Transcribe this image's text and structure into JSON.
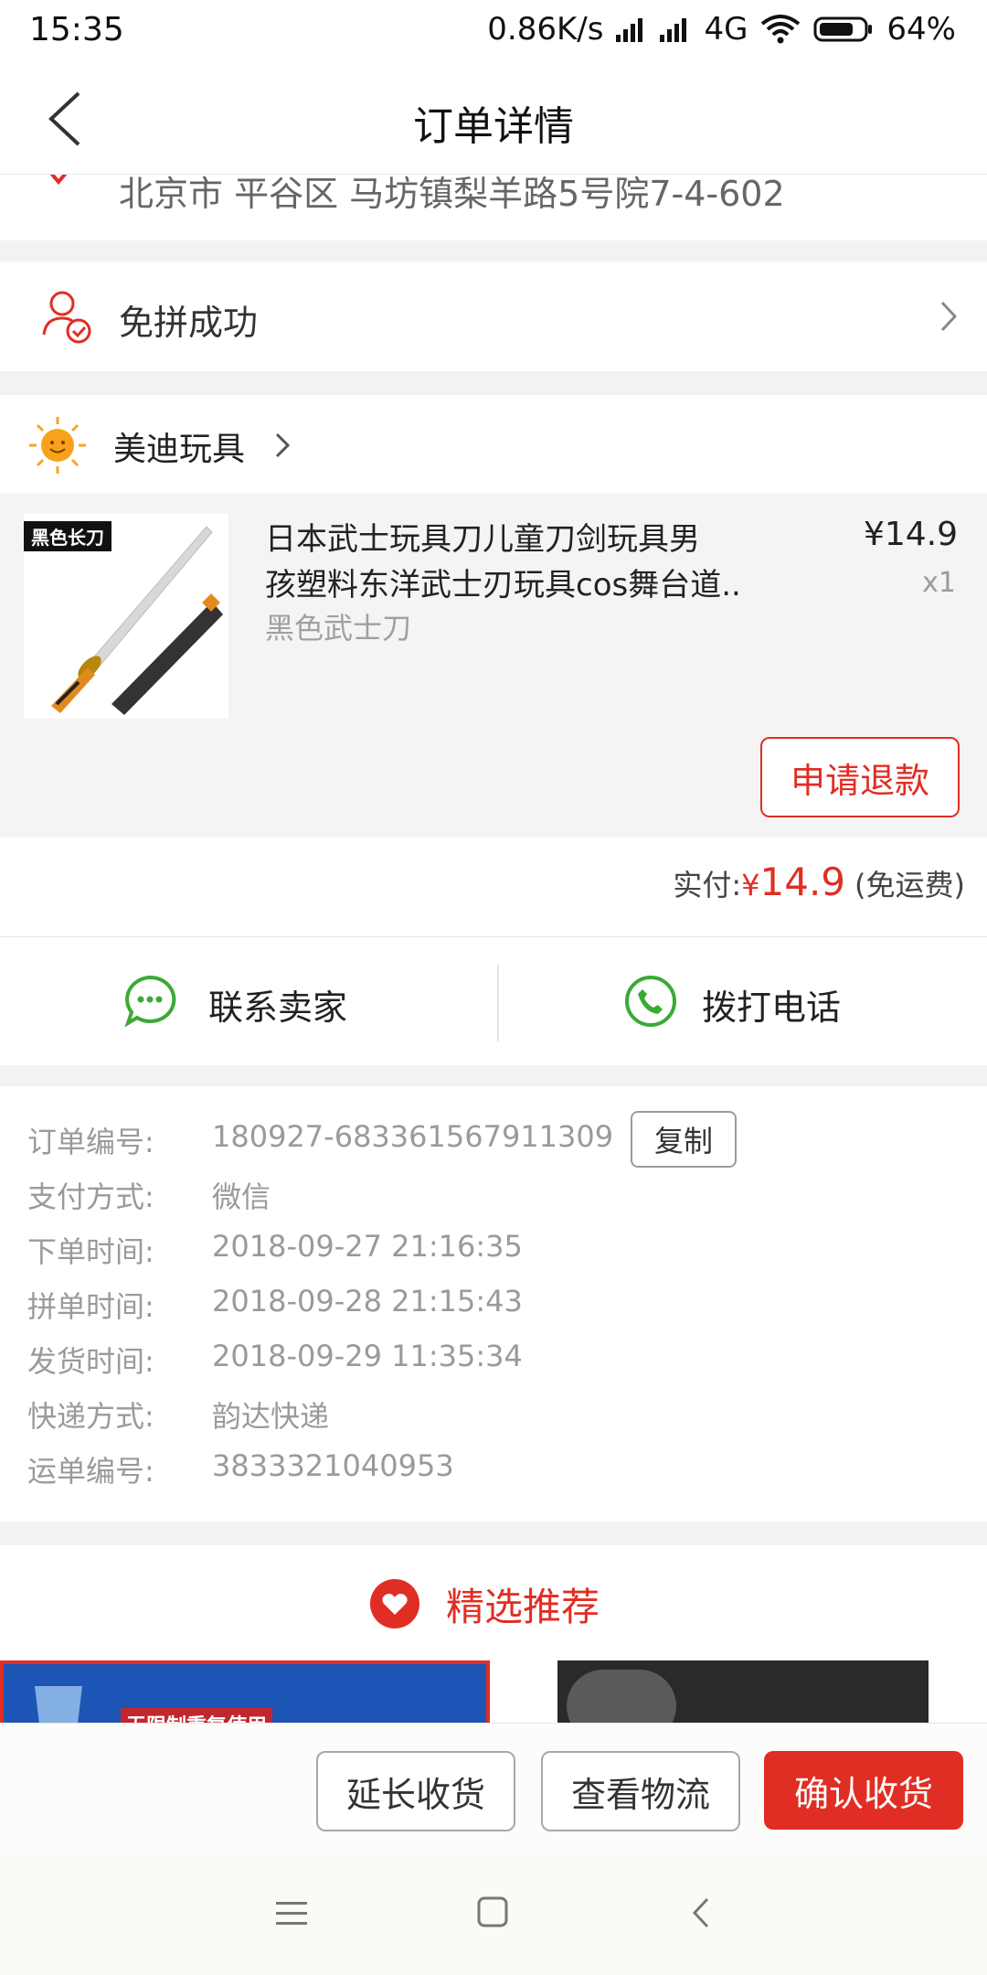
{
  "status_bar": {
    "time": "15:35",
    "net_speed": "0.86K/s",
    "network": "4G",
    "battery": "64%"
  },
  "nav": {
    "title": "订单详情"
  },
  "address": {
    "text": "北京市 平谷区 马坊镇梨羊路5号院7-4-602"
  },
  "group": {
    "status": "免拼成功"
  },
  "shop": {
    "name": "美迪玩具"
  },
  "product": {
    "image_tag": "黑色长刀",
    "title_line1": "日本武士玩具刀儿童刀剑玩具男",
    "title_line2": "孩塑料东洋武士刃玩具cos舞台道..",
    "spec": "黑色武士刀",
    "price": "¥14.9",
    "quantity": "x1",
    "refund_button": "申请退款"
  },
  "payment": {
    "label": "实付:",
    "currency": "¥",
    "amount": "14.9",
    "note": "(免运费)"
  },
  "contact": {
    "seller": "联系卖家",
    "phone": "拨打电话"
  },
  "order_info": {
    "copy_button": "复制",
    "rows": [
      {
        "label": "订单编号:",
        "value": "180927-683361567911309"
      },
      {
        "label": "支付方式:",
        "value": "微信"
      },
      {
        "label": "下单时间:",
        "value": "2018-09-27 21:16:35"
      },
      {
        "label": "拼单时间:",
        "value": "2018-09-28 21:15:43"
      },
      {
        "label": "发货时间:",
        "value": "2018-09-29 11:35:34"
      },
      {
        "label": "快递方式:",
        "value": "韵达快递"
      },
      {
        "label": "运单编号:",
        "value": "3833321040953"
      }
    ]
  },
  "recommend": {
    "title": "精选推荐",
    "card1_text": "无限制重复使用"
  },
  "actions": {
    "extend": "延长收货",
    "logistics": "查看物流",
    "confirm": "确认收货"
  },
  "colors": {
    "accent_red": "#e02e24",
    "green": "#3aaa35"
  }
}
